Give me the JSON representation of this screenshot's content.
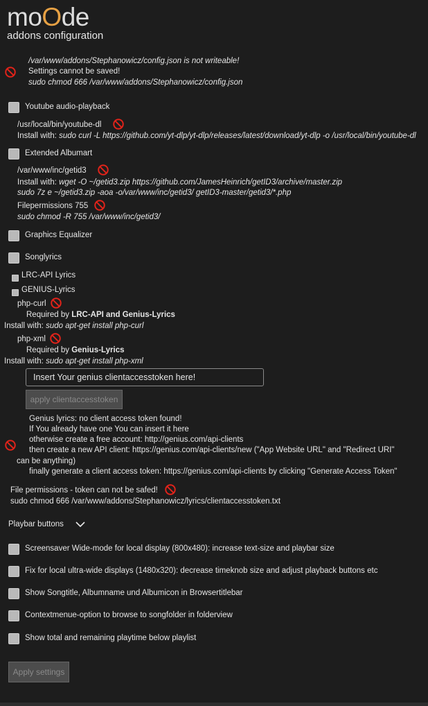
{
  "header": {
    "logo_prefix": "mo",
    "logo_o": "O",
    "logo_suffix": "de",
    "subtitle": "addons configuration"
  },
  "config_warning": {
    "line1": "/var/www/addons/Stephanowicz/config.json is not writeable!",
    "line2": "Settings cannot be saved!",
    "line3": "sudo chmod 666 /var/www/addons/Stephanowicz/config.json"
  },
  "youtube": {
    "label": "Youtube audio-playback",
    "path": "/usr/local/bin/youtube-dl",
    "install_prefix": "Install with:",
    "install_cmd": "sudo curl -L https://github.com/yt-dlp/yt-dlp/releases/latest/download/yt-dlp -o /usr/local/bin/youtube-dl"
  },
  "albumart": {
    "label": "Extended Albumart",
    "path": "/var/www/inc/getid3",
    "install_prefix": "Install with:",
    "install_cmd1": "wget -O ~/getid3.zip https://github.com/JamesHeinrich/getID3/archive/master.zip",
    "install_cmd2": "sudo 7z e ~/getid3.zip -aoa -o/var/www/inc/getid3/ getID3-master/getid3/*.php",
    "perm_label": "Filepermissions 755",
    "perm_cmd": "sudo chmod -R 755 /var/www/inc/getid3/"
  },
  "equalizer": {
    "label": "Graphics Equalizer"
  },
  "songlyrics": {
    "label": "Songlyrics",
    "lrc_label": "LRC-API Lyrics",
    "genius_label": "GENIUS-Lyrics",
    "curl_label": "php-curl",
    "curl_req_prefix": "Required by",
    "curl_req_bold": "LRC-API and Genius-Lyrics",
    "curl_install_prefix": "Install with:",
    "curl_install_cmd": "sudo apt-get install php-curl",
    "xml_label": "php-xml",
    "xml_req_prefix": "Required by",
    "xml_req_bold": "Genius-Lyrics",
    "xml_install_prefix": "Install with:",
    "xml_install_cmd": "sudo apt-get install php-xml"
  },
  "token": {
    "placeholder": "Insert Your genius clientaccesstoken here!",
    "apply_label": "apply clientaccesstoken"
  },
  "genius_warning": {
    "line1": "Genius lyrics: no client access token found!",
    "line2": "If You already have one You can insert it here",
    "line3": "otherwise create a free account: http://genius.com/api-clients",
    "line4": "then create a new API client: https://genius.com/api-clients/new (\"App Website URL\" and \"Redirect URI\"",
    "line5": "can be anything)",
    "line6": "finally generate a client access token: https://genius.com/api-clients by clicking \"Generate Access Token\""
  },
  "file_perm": {
    "label": "File permissions - token can not be safed!",
    "cmd": "sudo chmod 666 /var/www/addons/Stephanowicz/lyrics/clientaccesstoken.txt"
  },
  "playbar": {
    "label": "Playbar buttons"
  },
  "options": [
    "Screensaver Wide-mode for local display (800x480): increase text-size and playbar size",
    "Fix for local ultra-wide displays (1480x320): decrease timeknob size and adjust playback buttons etc",
    "Show Songtitle, Albumname und Albumicon in Browsertitlebar",
    "Contextmenue-option to browse to songfolder in folderview",
    "Show total and remaining playtime below playlist"
  ],
  "apply_settings_label": "Apply settings",
  "colors": {
    "accent": "#e7a144",
    "warning": "#e2231a",
    "background": "#1d1d1d"
  }
}
